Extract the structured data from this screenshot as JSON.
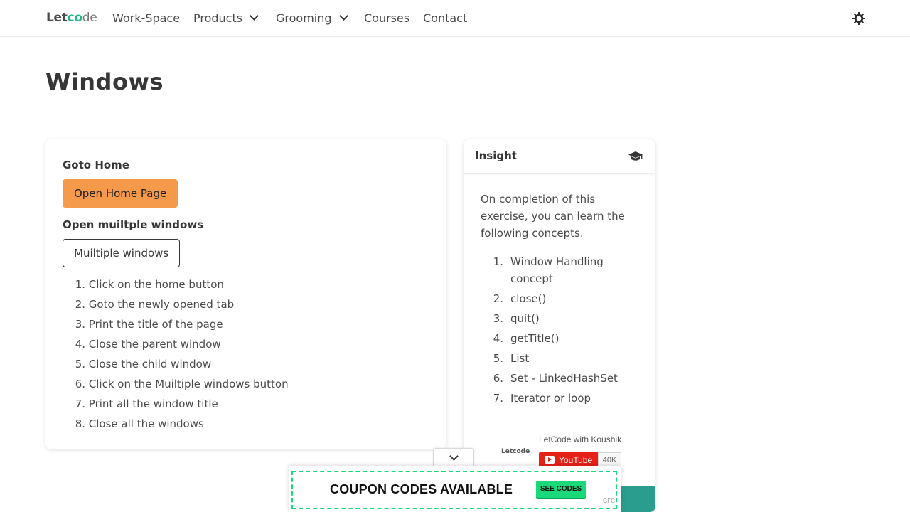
{
  "navbar": {
    "logo": {
      "part1": "Let",
      "o": "c",
      "o2": "o",
      "part2": "de"
    },
    "items": [
      {
        "label": "Work-Space",
        "has_dropdown": false
      },
      {
        "label": "Products",
        "has_dropdown": true
      },
      {
        "label": "Grooming",
        "has_dropdown": true
      },
      {
        "label": "Courses",
        "has_dropdown": false
      },
      {
        "label": "Contact",
        "has_dropdown": false
      }
    ],
    "theme_icon": "sun-icon"
  },
  "page": {
    "title": "Windows"
  },
  "exercise": {
    "goto_home_label": "Goto Home",
    "open_home_button": "Open Home Page",
    "open_multiple_label": "Open muiltple windows",
    "multiple_windows_button": "Muiltiple windows",
    "steps": [
      {
        "n": "1.",
        "text": "Click on the home button"
      },
      {
        "n": "2.",
        "text": "Goto the newly opened tab"
      },
      {
        "n": "3.",
        "text": "Print the title of the page"
      },
      {
        "n": "4.",
        "text": "Close the parent window"
      },
      {
        "n": "5.",
        "text": "Close the child window"
      },
      {
        "n": "6.",
        "text": "Click on the Muiltiple windows button"
      },
      {
        "n": "7.",
        "text": "Print all the window title"
      },
      {
        "n": "8.",
        "text": "Close all the windows"
      }
    ]
  },
  "insight": {
    "title": "Insight",
    "icon": "graduation-cap-icon",
    "intro": "On completion of this exercise, you can learn the following concepts.",
    "concepts": [
      {
        "n": "1.",
        "text": "Window Handling concept"
      },
      {
        "n": "2.",
        "text": "close()"
      },
      {
        "n": "3.",
        "text": "quit()"
      },
      {
        "n": "4.",
        "text": "getTitle()"
      },
      {
        "n": "5.",
        "text": "List"
      },
      {
        "n": "6.",
        "text": "Set - LinkedHashSet"
      },
      {
        "n": "7.",
        "text": "Iterator or loop"
      }
    ],
    "youtube": {
      "logo_text": "Letcode",
      "channel": "LetCode with Koushik",
      "button": "YouTube",
      "subscribers": "40K"
    }
  },
  "ad": {
    "headline": "COUPON CODES AVAILABLE",
    "button": "SEE CODES",
    "mark": "GFC"
  },
  "colors": {
    "primary_orange": "#f59a4a",
    "teal": "#2a9d8f",
    "ad_green": "#19d97b",
    "youtube_red": "#e62117"
  }
}
